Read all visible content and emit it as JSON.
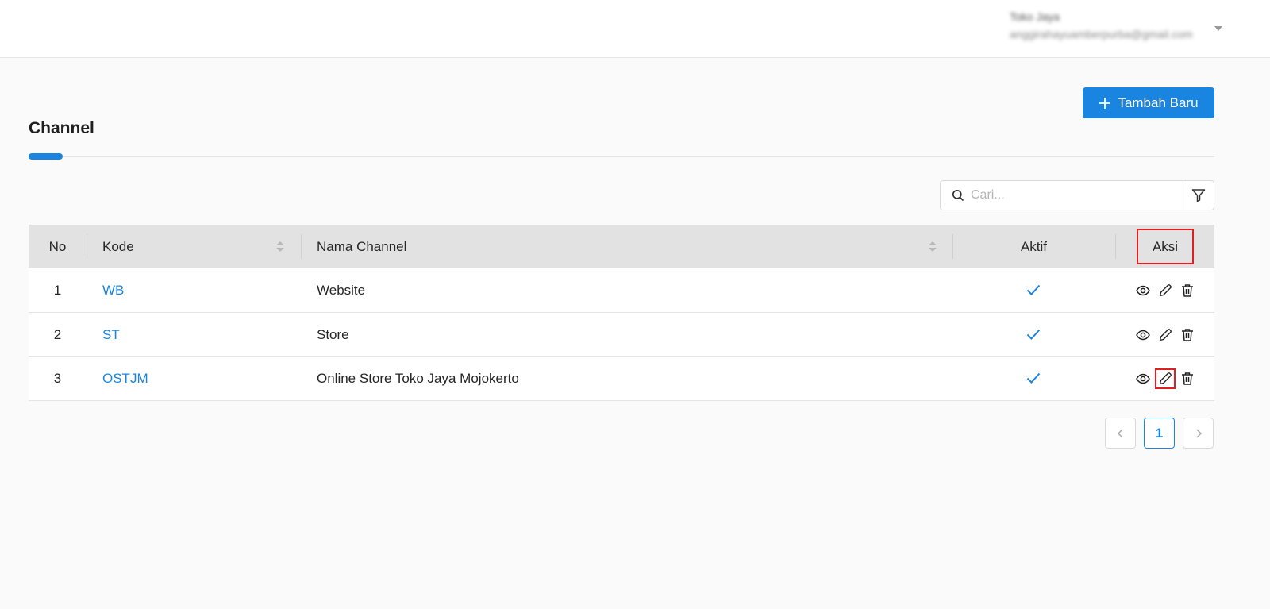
{
  "header": {
    "user_name": "Toko Jaya",
    "user_email": "anggirahayuamberpurba@gmail.com"
  },
  "page": {
    "title": "Channel",
    "add_button_label": "Tambah Baru"
  },
  "search": {
    "placeholder": "Cari..."
  },
  "table": {
    "columns": {
      "no": "No",
      "kode": "Kode",
      "nama": "Nama Channel",
      "aktif": "Aktif",
      "aksi": "Aksi"
    },
    "rows": [
      {
        "no": "1",
        "kode": "WB",
        "nama": "Website",
        "aktif": true
      },
      {
        "no": "2",
        "kode": "ST",
        "nama": "Store",
        "aktif": true
      },
      {
        "no": "3",
        "kode": "OSTJM",
        "nama": "Online Store Toko Jaya Mojokerto",
        "aktif": true
      }
    ]
  },
  "pagination": {
    "current_page": "1"
  },
  "colors": {
    "accent": "#1a85e0",
    "highlight": "#e02020"
  },
  "icons": [
    "plus-icon",
    "search-icon",
    "filter-icon",
    "view-icon",
    "edit-icon",
    "delete-icon",
    "check-icon",
    "chevron-left-icon",
    "chevron-right-icon",
    "caret-down-icon"
  ]
}
